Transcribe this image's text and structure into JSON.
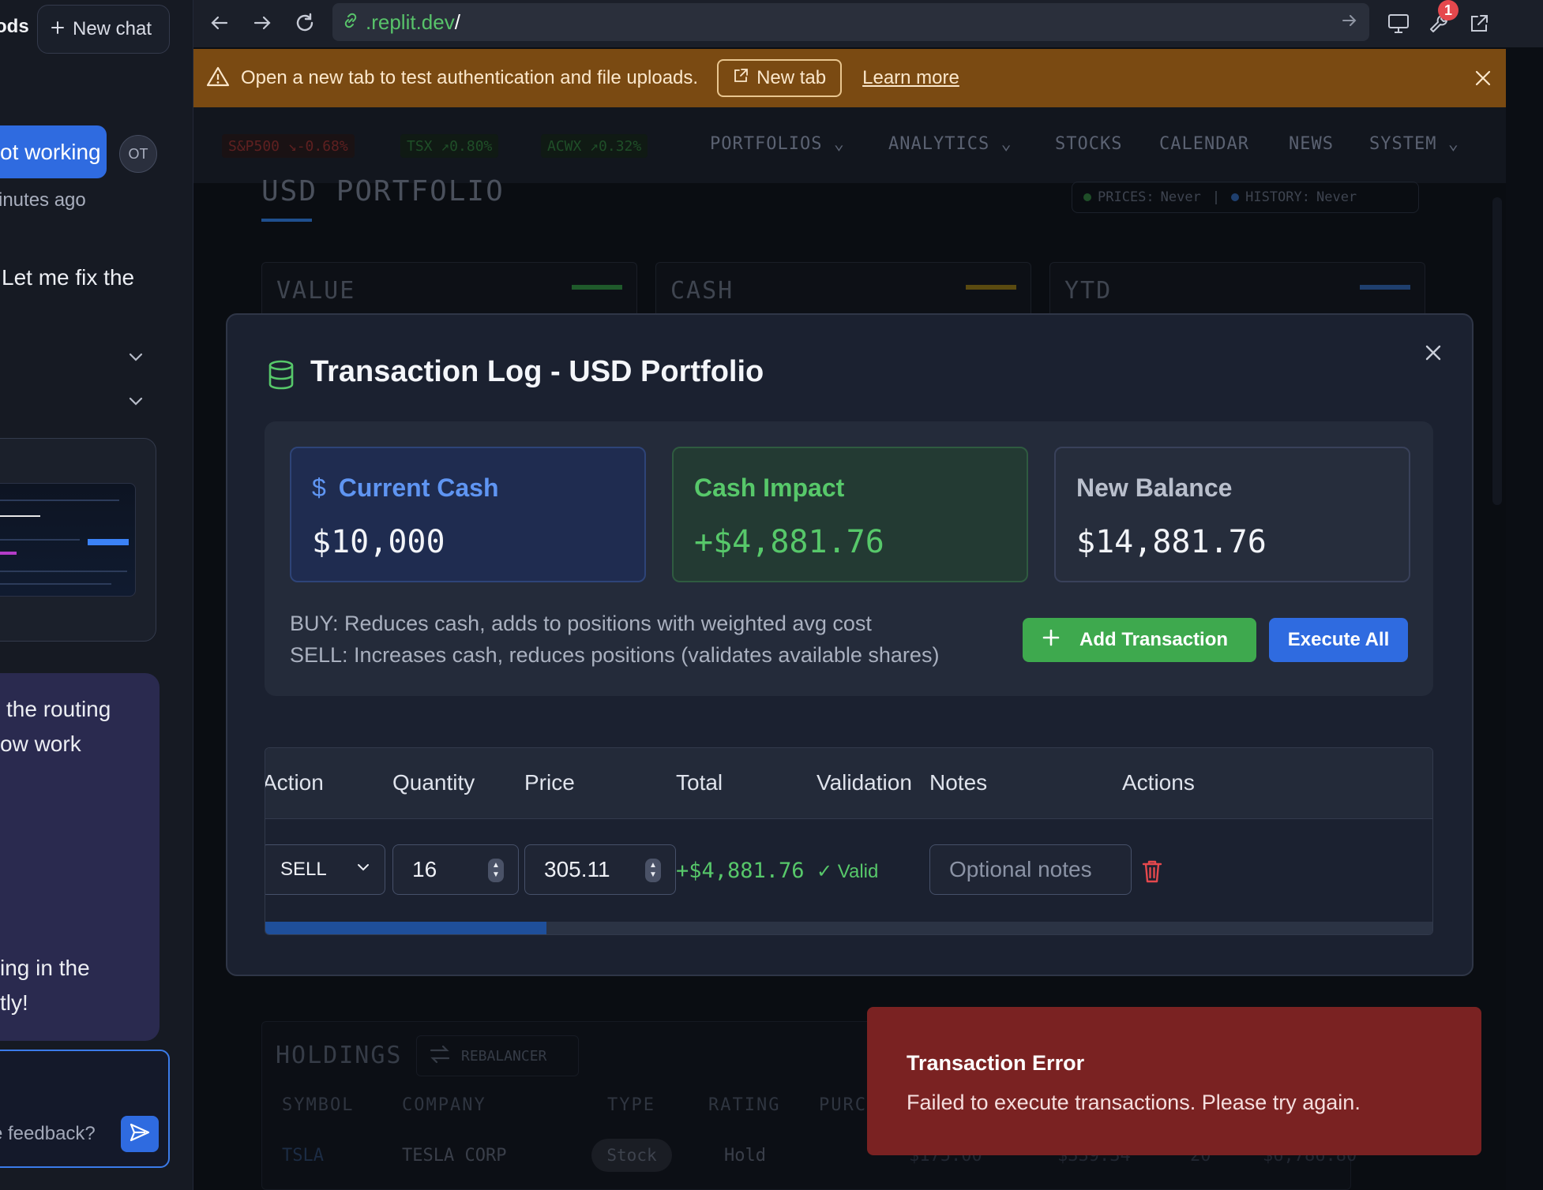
{
  "chat": {
    "heading_fragment": "ods",
    "new_chat_label": "New chat",
    "user_message_fragment": "ot working",
    "user_avatar": "OT",
    "timestamp_fragment": "inutes ago",
    "assistant_text_fragment": "Let me fix the",
    "bubble_lines": [
      "the routing",
      "ow work"
    ],
    "bubble_lines_bottom": [
      "ing in the",
      "tly!"
    ],
    "input_placeholder_fragment": "e feedback?"
  },
  "browser": {
    "url_prefix": ".replit.dev",
    "url_suffix": "/",
    "notification_count": "1",
    "warning": {
      "message": "Open a new tab to test authentication and file uploads.",
      "new_tab_label": "New tab",
      "learn_more_label": "Learn more"
    }
  },
  "app": {
    "tickers": [
      {
        "label": "S&P500 ↘-0.68%",
        "color": "#5e2020",
        "bg": "#1a1214"
      },
      {
        "label": "TSX ↗0.80%",
        "color": "#1f4e28",
        "bg": "#101a14"
      },
      {
        "label": "ACWX ↗0.32%",
        "color": "#1f4e28",
        "bg": "#101a14"
      }
    ],
    "nav": [
      "PORTFOLIOS",
      "ANALYTICS",
      "STOCKS",
      "CALENDAR",
      "NEWS",
      "SYSTEM"
    ],
    "page_title": "USD PORTFOLIO",
    "status": {
      "prices_label": "PRICES:",
      "prices_value": "Never",
      "sep": "|",
      "history_label": "HISTORY:",
      "history_value": "Never"
    },
    "kpis": [
      {
        "label": "VALUE",
        "accent": "#1f5a2b"
      },
      {
        "label": "CASH",
        "accent": "#5a4a10"
      },
      {
        "label": "YTD",
        "accent": "#1f3f6e"
      }
    ],
    "holdings": {
      "title": "HOLDINGS",
      "rebalancer_label": "REBALANCER",
      "columns": [
        "SYMBOL",
        "COMPANY",
        "TYPE",
        "RATING",
        "PURC"
      ],
      "row": {
        "symbol": "TSLA",
        "company": "TESLA CORP",
        "type": "Stock",
        "rating": "Hold",
        "c1": "$175.00",
        "c2": "$339.34",
        "c3": "20",
        "c4": "$6,786.80"
      }
    }
  },
  "modal": {
    "title": "Transaction Log - USD Portfolio",
    "current_cash": {
      "label": "Current Cash",
      "value": "$10,000"
    },
    "cash_impact": {
      "label": "Cash Impact",
      "value": "+$4,881.76"
    },
    "new_balance": {
      "label": "New Balance",
      "value": "$14,881.76"
    },
    "rules": [
      "BUY: Reduces cash, adds to positions with weighted avg cost",
      "SELL: Increases cash, reduces positions (validates available shares)"
    ],
    "add_label": "Add Transaction",
    "execute_label": "Execute All",
    "table": {
      "columns": [
        "Action",
        "Quantity",
        "Price",
        "Total",
        "Validation",
        "Notes",
        "Actions"
      ],
      "row": {
        "action": "SELL",
        "quantity": "16",
        "price": "305.11",
        "total": "+$4,881.76",
        "validation": "✓ Valid",
        "notes_placeholder": "Optional notes"
      }
    }
  },
  "toast": {
    "title": "Transaction Error",
    "message": "Failed to execute transactions. Please try again."
  },
  "colors": {
    "accent_blue": "#2f6be0",
    "accent_green": "#3ea94e",
    "positive": "#57c86a",
    "error_bg": "#7a2222",
    "warning_bg": "#7a4a12"
  }
}
